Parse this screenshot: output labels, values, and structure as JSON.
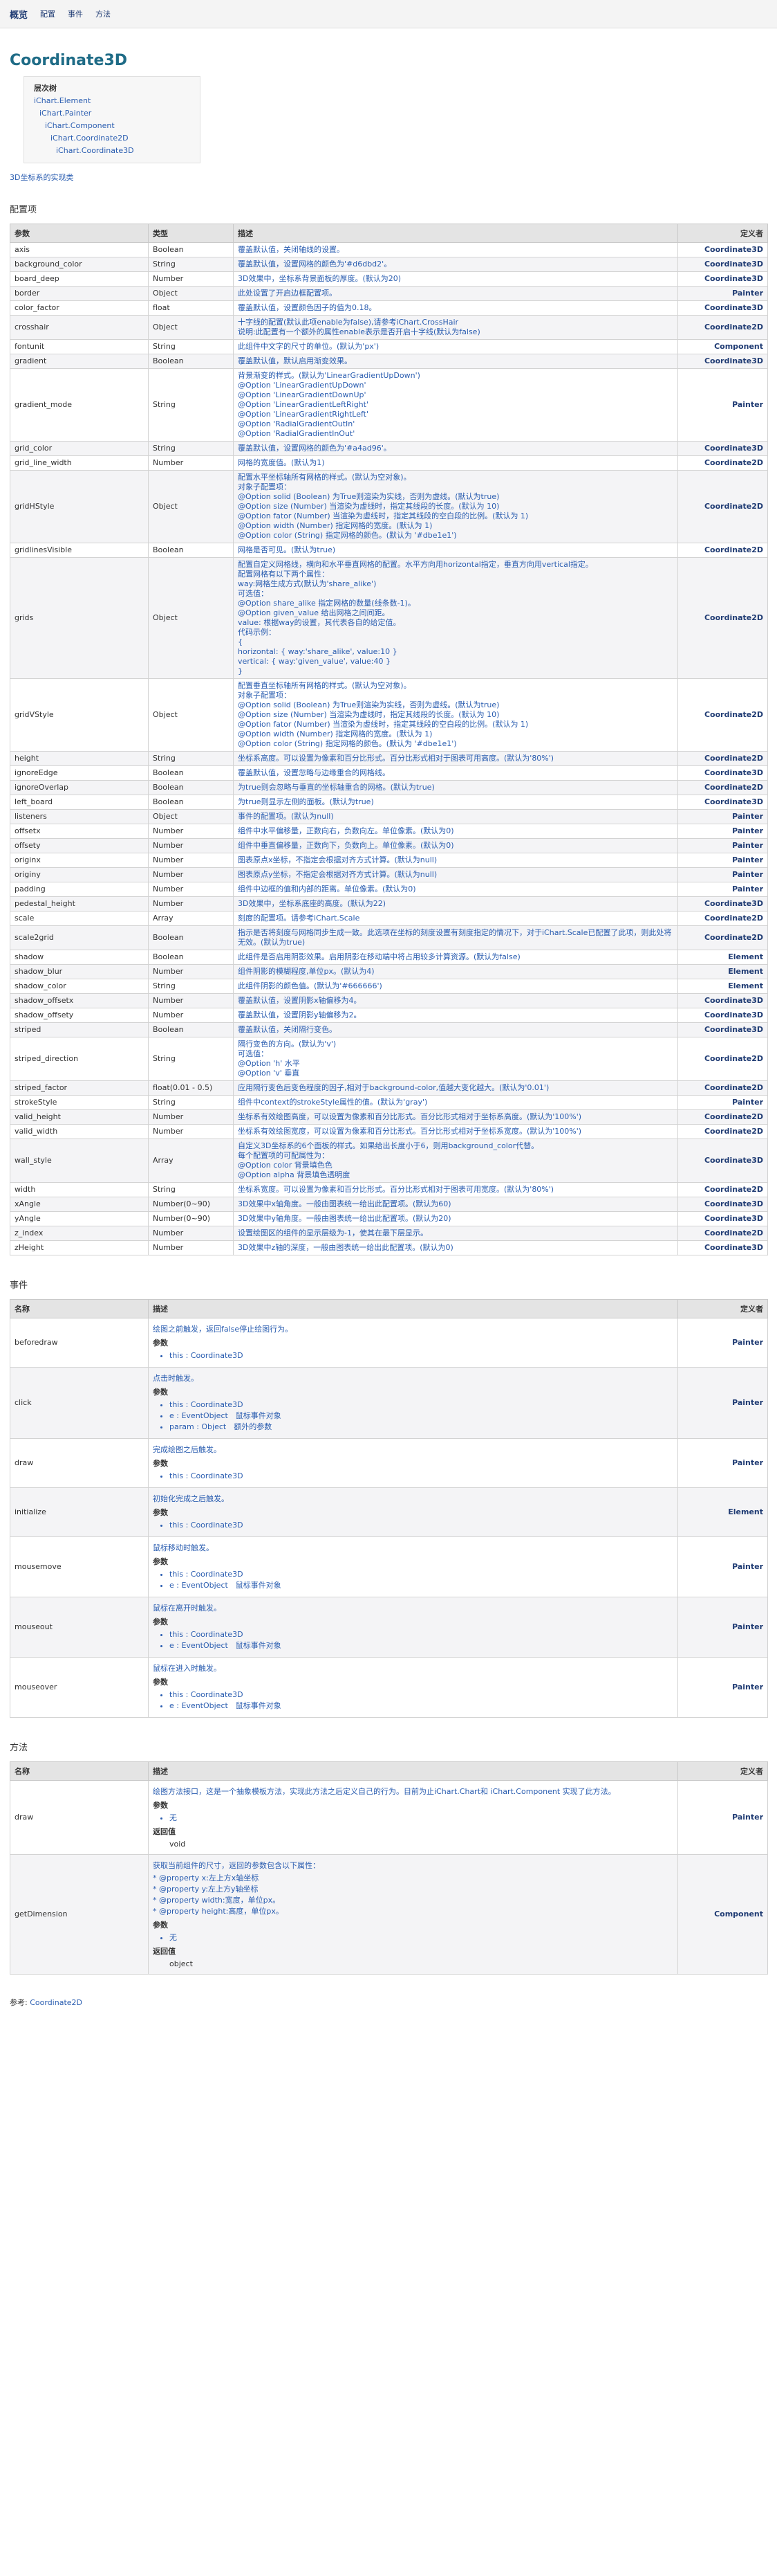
{
  "nav": {
    "brand": "概览",
    "items": [
      "配置",
      "事件",
      "方法"
    ]
  },
  "title": "Coordinate3D",
  "hierarchy": {
    "heading": "层次树",
    "items": [
      "iChart.Element",
      "iChart.Painter",
      "iChart.Component",
      "iChart.Coordinate2D",
      "iChart.Coordinate3D"
    ]
  },
  "description": "3D坐标系的实现类",
  "config": {
    "heading": "配置项",
    "headers": [
      "参数",
      "类型",
      "描述",
      "定义者"
    ],
    "rows": [
      [
        "axis",
        "Boolean",
        "覆盖默认值，关闭轴线的设置。",
        "Coordinate3D"
      ],
      [
        "background_color",
        "String",
        "覆盖默认值，设置网格的颜色为'#d6dbd2'。",
        "Coordinate3D"
      ],
      [
        "board_deep",
        "Number",
        "3D效果中，坐标系背景面板的厚度。(默认为20)",
        "Coordinate3D"
      ],
      [
        "border",
        "Object",
        "此处设置了开启边框配置项。",
        "Painter"
      ],
      [
        "color_factor",
        "float",
        "覆盖默认值，设置颜色因子的值为0.18。",
        "Coordinate3D"
      ],
      [
        "crosshair",
        "Object",
        "十字线的配置(默认此项enable为false),请参考iChart.CrossHair\n说明:此配置有一个额外的属性enable表示是否开启十字线(默认为false)",
        "Coordinate2D"
      ],
      [
        "fontunit",
        "String",
        "此组件中文字的尺寸的单位。(默认为'px')",
        "Component"
      ],
      [
        "gradient",
        "Boolean",
        "覆盖默认值，默认启用渐变效果。",
        "Coordinate3D"
      ],
      [
        "gradient_mode",
        "String",
        "背景渐变的样式。(默认为'LinearGradientUpDown')\n@Option 'LinearGradientUpDown'\n@Option 'LinearGradientDownUp'\n@Option 'LinearGradientLeftRight'\n@Option 'LinearGradientRightLeft'\n@Option 'RadialGradientOutIn'\n@Option 'RadialGradientInOut'",
        "Painter"
      ],
      [
        "grid_color",
        "String",
        "覆盖默认值，设置网格的颜色为'#a4ad96'。",
        "Coordinate3D"
      ],
      [
        "grid_line_width",
        "Number",
        "网格的宽度值。(默认为1)",
        "Coordinate2D"
      ],
      [
        "gridHStyle",
        "Object",
        "配置水平坐标轴所有网格的样式。(默认为空对象)。\n对象子配置项：\n@Option solid (Boolean) 为True则渲染为实线，否则为虚线。(默认为true)\n@Option size (Number) 当渲染为虚线时，指定其线段的长度。(默认为 10)\n@Option fator (Number) 当渲染为虚线时，指定其线段的空白段的比例。(默认为 1)\n@Option width (Number) 指定网格的宽度。(默认为 1)\n@Option color (String) 指定网格的颜色。(默认为 '#dbe1e1')",
        "Coordinate2D"
      ],
      [
        "gridlinesVisible",
        "Boolean",
        "网格是否可见。(默认为true)",
        "Coordinate2D"
      ],
      [
        "grids",
        "Object",
        "配置自定义网格线，横向和水平垂直网格的配置。水平方向用horizontal指定，垂直方向用vertical指定。\n配置网格有以下两个属性：\nway:网格生成方式(默认为'share_alike')\n可选值：\n@Option share_alike 指定网格的数量(线条数-1)。\n@Option given_value 给出网格之间间距。\nvalue: 根据way的设置，其代表各自的给定值。\n代码示例：\n{\nhorizontal: { way:'share_alike', value:10 }\nvertical: { way:'given_value', value:40 }\n}",
        "Coordinate2D"
      ],
      [
        "gridVStyle",
        "Object",
        "配置垂直坐标轴所有网格的样式。(默认为空对象)。\n对象子配置项：\n@Option solid (Boolean) 为True则渲染为实线，否则为虚线。(默认为true)\n@Option size (Number) 当渲染为虚线时，指定其线段的长度。(默认为 10)\n@Option fator (Number) 当渲染为虚线时，指定其线段的空白段的比例。(默认为 1)\n@Option width (Number) 指定网格的宽度。(默认为 1)\n@Option color (String) 指定网格的颜色。(默认为 '#dbe1e1')",
        "Coordinate2D"
      ],
      [
        "height",
        "String",
        "坐标系高度。可以设置为像素和百分比形式。百分比形式相对于图表可用高度。(默认为'80%')",
        "Coordinate2D"
      ],
      [
        "ignoreEdge",
        "Boolean",
        "覆盖默认值，设置忽略与边缘重合的网格线。",
        "Coordinate3D"
      ],
      [
        "ignoreOverlap",
        "Boolean",
        "为true则会忽略与垂直的坐标轴重合的网格。(默认为true)",
        "Coordinate2D"
      ],
      [
        "left_board",
        "Boolean",
        "为true则显示左侧的面板。(默认为true)",
        "Coordinate3D"
      ],
      [
        "listeners",
        "Object",
        "事件的配置项。(默认为null)",
        "Painter"
      ],
      [
        "offsetx",
        "Number",
        "组件中水平偏移量，正数向右，负数向左。单位像素。(默认为0)",
        "Painter"
      ],
      [
        "offsety",
        "Number",
        "组件中垂直偏移量，正数向下，负数向上。单位像素。(默认为0)",
        "Painter"
      ],
      [
        "originx",
        "Number",
        "图表原点x坐标，不指定会根据对齐方式计算。(默认为null)",
        "Painter"
      ],
      [
        "originy",
        "Number",
        "图表原点y坐标，不指定会根据对齐方式计算。(默认为null)",
        "Painter"
      ],
      [
        "padding",
        "Number",
        "组件中边框的值和内部的距离。单位像素。(默认为0)",
        "Painter"
      ],
      [
        "pedestal_height",
        "Number",
        "3D效果中，坐标系底座的高度。(默认为22)",
        "Coordinate3D"
      ],
      [
        "scale",
        "Array",
        "刻度的配置项。请参考iChart.Scale",
        "Coordinate2D"
      ],
      [
        "scale2grid",
        "Boolean",
        "指示是否将刻度与网格同步生成一致。此选项在坐标的刻度设置有刻度指定的情况下，对于iChart.Scale已配置了此项，则此处将无效。(默认为true)",
        "Coordinate2D"
      ],
      [
        "shadow",
        "Boolean",
        "此组件是否启用阴影效果。启用阴影在移动端中将占用较多计算资源。(默认为false)",
        "Element"
      ],
      [
        "shadow_blur",
        "Number",
        "组件阴影的模糊程度,单位px。(默认为4)",
        "Element"
      ],
      [
        "shadow_color",
        "String",
        "此组件阴影的颜色值。(默认为'#666666')",
        "Element"
      ],
      [
        "shadow_offsetx",
        "Number",
        "覆盖默认值，设置阴影x轴偏移为4。",
        "Coordinate3D"
      ],
      [
        "shadow_offsety",
        "Number",
        "覆盖默认值，设置阴影y轴偏移为2。",
        "Coordinate3D"
      ],
      [
        "striped",
        "Boolean",
        "覆盖默认值，关闭隔行变色。",
        "Coordinate3D"
      ],
      [
        "striped_direction",
        "String",
        "隔行变色的方向。(默认为'v')\n可选值：\n@Option 'h' 水平\n@Option 'v' 垂直",
        "Coordinate2D"
      ],
      [
        "striped_factor",
        "float(0.01 - 0.5)",
        "应用隔行变色后变色程度的因子,相对于background-color,值越大变化越大。(默认为'0.01')",
        "Coordinate2D"
      ],
      [
        "strokeStyle",
        "String",
        "组件中context的strokeStyle属性的值。(默认为'gray')",
        "Painter"
      ],
      [
        "valid_height",
        "Number",
        "坐标系有效绘图高度，可以设置为像素和百分比形式。百分比形式相对于坐标系高度。(默认为'100%')",
        "Coordinate2D"
      ],
      [
        "valid_width",
        "Number",
        "坐标系有效绘图宽度，可以设置为像素和百分比形式。百分比形式相对于坐标系宽度。(默认为'100%')",
        "Coordinate2D"
      ],
      [
        "wall_style",
        "Array",
        "自定义3D坐标系的6个面板的样式。如果给出长度小于6，则用background_color代替。\n每个配置项的可配属性为：\n@Option color 背景填色色\n@Option alpha 背景填色透明度",
        "Coordinate3D"
      ],
      [
        "width",
        "String",
        "坐标系宽度。可以设置为像素和百分比形式。百分比形式相对于图表可用宽度。(默认为'80%')",
        "Coordinate2D"
      ],
      [
        "xAngle",
        "Number(0~90)",
        "3D效果中x轴角度。一般由图表统一给出此配置项。(默认为60)",
        "Coordinate3D"
      ],
      [
        "yAngle",
        "Number(0~90)",
        "3D效果中y轴角度。一般由图表统一给出此配置项。(默认为20)",
        "Coordinate3D"
      ],
      [
        "z_index",
        "Number",
        "设置绘图区的组件的显示层级为-1，使其在最下层显示。",
        "Coordinate2D"
      ],
      [
        "zHeight",
        "Number",
        "3D效果中z轴的深度，一般由图表统一给出此配置项。(默认为0)",
        "Coordinate3D"
      ]
    ]
  },
  "events": {
    "heading": "事件",
    "headers": [
      "名称",
      "描述",
      "定义者"
    ],
    "param_label": "参数",
    "rows": [
      {
        "name": "beforedraw",
        "desc": "绘图之前触发，返回false停止绘图行为。",
        "params": [
          "this : Coordinate3D"
        ],
        "owner": "Painter"
      },
      {
        "name": "click",
        "desc": "点击时触发。",
        "params": [
          "this : Coordinate3D",
          "e : EventObject　鼠标事件对象",
          "param : Object　额外的参数"
        ],
        "owner": "Painter"
      },
      {
        "name": "draw",
        "desc": "完成绘图之后触发。",
        "params": [
          "this : Coordinate3D"
        ],
        "owner": "Painter"
      },
      {
        "name": "initialize",
        "desc": "初始化完成之后触发。",
        "params": [
          "this : Coordinate3D"
        ],
        "owner": "Element"
      },
      {
        "name": "mousemove",
        "desc": "鼠标移动时触发。",
        "params": [
          "this : Coordinate3D",
          "e : EventObject　鼠标事件对象"
        ],
        "owner": "Painter"
      },
      {
        "name": "mouseout",
        "desc": "鼠标在离开时触发。",
        "params": [
          "this : Coordinate3D",
          "e : EventObject　鼠标事件对象"
        ],
        "owner": "Painter"
      },
      {
        "name": "mouseover",
        "desc": "鼠标在进入时触发。",
        "params": [
          "this : Coordinate3D",
          "e : EventObject　鼠标事件对象"
        ],
        "owner": "Painter"
      }
    ]
  },
  "methods": {
    "heading": "方法",
    "headers": [
      "名称",
      "描述",
      "定义者"
    ],
    "param_label": "参数",
    "return_label": "返回值",
    "rows": [
      {
        "name": "draw",
        "desc": "绘图方法接口，这是一个抽象模板方法，实现此方法之后定义自己的行为。目前为止iChart.Chart和 iChart.Component 实现了此方法。",
        "props": [],
        "params": [
          "无"
        ],
        "ret": "void",
        "owner": "Painter"
      },
      {
        "name": "getDimension",
        "desc": "获取当前组件的尺寸，返回的参数包含以下属性：",
        "props": [
          "@property x:左上方x轴坐标",
          "@property y:左上方y轴坐标",
          "@property width:宽度，单位px。",
          "@property height:高度，单位px。"
        ],
        "params": [
          "无"
        ],
        "ret": "object",
        "owner": "Component"
      }
    ]
  },
  "see": {
    "label": "参考:",
    "link": "Coordinate2D"
  }
}
